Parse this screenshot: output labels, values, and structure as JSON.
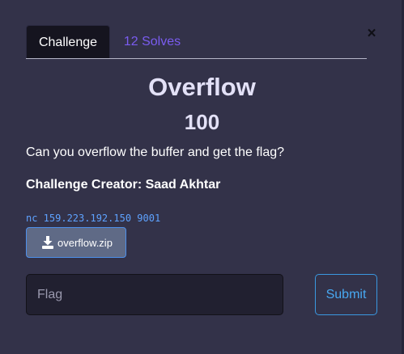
{
  "tabs": [
    {
      "label": "Challenge"
    },
    {
      "label": "12 Solves"
    }
  ],
  "close_symbol": "×",
  "challenge": {
    "name": "Overflow",
    "points": "100",
    "description": "Can you overflow the buffer and get the flag?",
    "creator": "Challenge Creator: Saad Akhtar",
    "connection": "nc 159.223.192.150 9001",
    "file": {
      "label": "overflow.zip",
      "icon": "download-icon"
    }
  },
  "form": {
    "flag_placeholder": "Flag",
    "flag_value": "",
    "submit_label": "Submit"
  },
  "colors": {
    "background": "#333249",
    "accent": "#7a5cf0",
    "link": "#5ea2ff",
    "submit": "#48a8f2"
  }
}
